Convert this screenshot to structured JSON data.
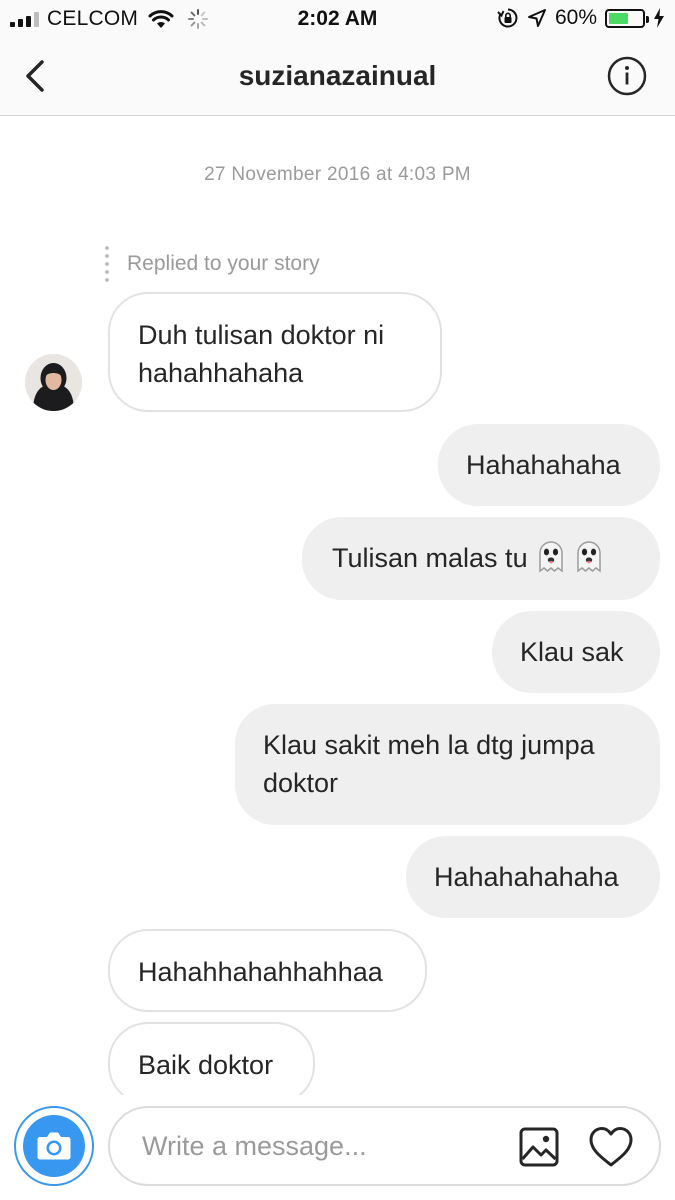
{
  "status_bar": {
    "carrier": "CELCOM",
    "time": "2:02 AM",
    "battery_percent": "60%",
    "battery_level": 0.6,
    "battery_color": "#4cd964"
  },
  "header": {
    "title": "suzianazainual",
    "back_icon": "chevron-left-icon",
    "info_icon": "info-circle-icon"
  },
  "chat": {
    "timestamp": "27 November 2016 at 4:03 PM",
    "reply_note": "Replied to your story",
    "messages": [
      {
        "side": "incoming",
        "text": "Duh tulisan doktor ni hahahhahaha"
      },
      {
        "side": "outgoing",
        "text": "Hahahahaha"
      },
      {
        "side": "outgoing",
        "text": "Tulisan malas tu",
        "emoji": [
          "ghost-emoji",
          "ghost-emoji"
        ]
      },
      {
        "side": "outgoing",
        "text": "Klau sak"
      },
      {
        "side": "outgoing",
        "text": "Klau sakit meh la dtg jumpa doktor"
      },
      {
        "side": "outgoing",
        "text": "Hahahahahaha"
      },
      {
        "side": "incoming",
        "text": "Hahahhahahhahhaa"
      },
      {
        "side": "incoming",
        "text": "Baik doktor"
      }
    ]
  },
  "composer": {
    "placeholder": "Write a message...",
    "camera_icon": "camera-icon",
    "gallery_icon": "gallery-icon",
    "heart_icon": "heart-icon",
    "accent": "#3897f0"
  }
}
